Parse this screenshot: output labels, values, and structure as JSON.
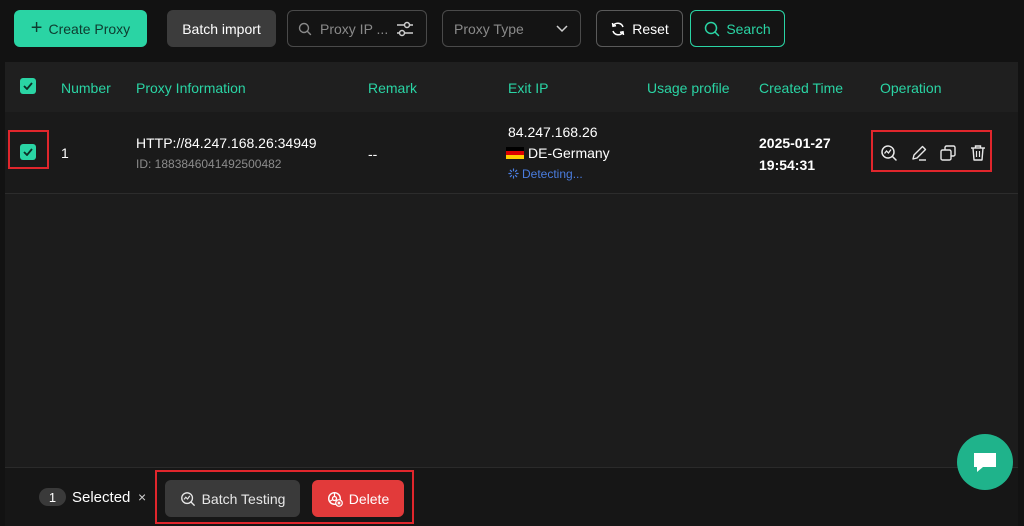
{
  "toolbar": {
    "create_label": "Create Proxy",
    "batch_import_label": "Batch import",
    "search_placeholder": "Proxy IP ...",
    "proxy_type_placeholder": "Proxy Type",
    "reset_label": "Reset",
    "search_label": "Search"
  },
  "table": {
    "headers": {
      "number": "Number",
      "proxy_info": "Proxy Information",
      "remark": "Remark",
      "exit_ip": "Exit IP",
      "usage_profile": "Usage profile",
      "created_time": "Created Time",
      "operation": "Operation"
    },
    "rows": [
      {
        "number": "1",
        "proxy": "HTTP://84.247.168.26:34949",
        "id": "ID: 1883846041492500482",
        "remark": "--",
        "exit_ip": "84.247.168.26",
        "country": "DE-Germany",
        "status": "Detecting...",
        "created_date": "2025-01-27",
        "created_time": "19:54:31"
      }
    ]
  },
  "bottom": {
    "count": "1",
    "selected_label": "Selected",
    "close": "×",
    "batch_testing_label": "Batch Testing",
    "delete_label": "Delete"
  },
  "colors": {
    "accent": "#2ad4a4",
    "danger": "#e23a3a",
    "highlight_box": "#e0262c",
    "status_blue": "#4a7de0"
  }
}
